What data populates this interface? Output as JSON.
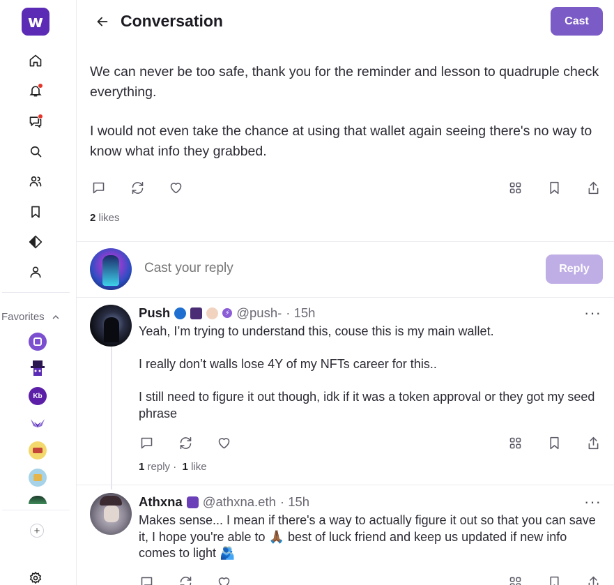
{
  "app": {
    "logo_letter": "w"
  },
  "header": {
    "title": "Conversation",
    "cast_label": "Cast"
  },
  "sidebar": {
    "favorites_label": "Favorites",
    "favorites": [
      {
        "name": "fav-channel-1",
        "text": "",
        "color": "#7b4fd0"
      },
      {
        "name": "fav-channel-2",
        "text": "",
        "color": "#3a1e6e"
      },
      {
        "name": "fav-channel-3",
        "text": "Kb",
        "color": "#5b1fa8"
      },
      {
        "name": "fav-channel-4",
        "text": "",
        "color": "#8a6dd6"
      },
      {
        "name": "fav-channel-5",
        "text": "",
        "color": "#f3d86b"
      },
      {
        "name": "fav-channel-6",
        "text": "",
        "color": "#a7d3e8"
      },
      {
        "name": "fav-channel-7",
        "text": "",
        "color": "#2f6b4b"
      }
    ]
  },
  "main_cast": {
    "paragraphs": [
      "We can never be too safe, thank you for the reminder and lesson to quadruple check everything.",
      "I would not even take the chance at using that wallet again seeing there's no way to know what info they grabbed."
    ],
    "likes_count": "2",
    "likes_label": "likes"
  },
  "reply_box": {
    "placeholder": "Cast your reply",
    "button_label": "Reply"
  },
  "comments": [
    {
      "name": "Push",
      "handle": "@push-",
      "time": "· 15h",
      "paragraphs": [
        "Yeah, I’m trying to understand this, couse this is my main wallet.",
        "I really don’t walls lose 4Y of my NFTs career for this..",
        "I still need to figure it out though, idk if it was a token approval or they got my seed phrase"
      ],
      "replies_count": "1",
      "replies_label": "reply ·",
      "likes_count": "1",
      "likes_label": "like"
    },
    {
      "name": "Athxna",
      "handle": "@athxna.eth",
      "time": "· 15h",
      "text": "Makes sense... I mean if there's a way to actually figure it out so that you can save it, I hope you're able to 🙏🏾 best of luck friend and keep us updated if new info comes to light 🫂"
    }
  ],
  "colors": {
    "accent": "#7b5bc6",
    "accent_light": "#bfaee6",
    "logo": "#5b2bb5",
    "notification_dot": "#e5352b"
  }
}
